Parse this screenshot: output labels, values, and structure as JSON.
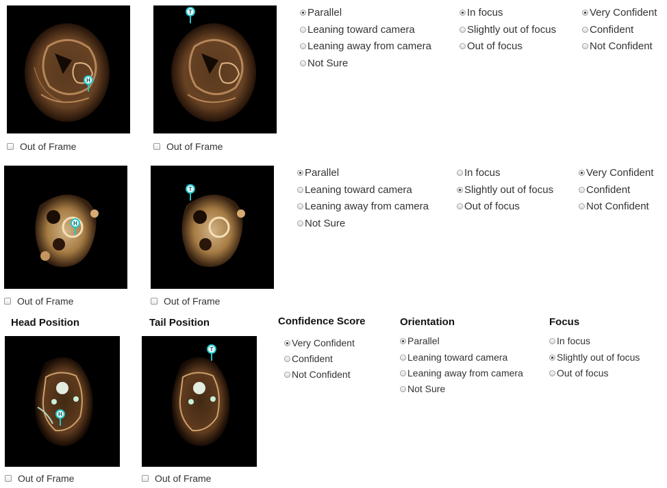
{
  "out_of_frame_label": "Out of Frame",
  "headers": {
    "head_position": "Head Position",
    "tail_position": "Tail Position",
    "confidence_score": "Confidence Score",
    "orientation": "Orientation",
    "focus": "Focus"
  },
  "orientation_options": [
    "Parallel",
    "Leaning toward camera",
    "Leaning away from camera",
    "Not Sure"
  ],
  "focus_options": [
    "In focus",
    "Slightly out of focus",
    "Out of focus"
  ],
  "confidence_options": [
    "Very Confident",
    "Confident",
    "Not Confident"
  ],
  "markers": {
    "head": "H",
    "tail": "T"
  },
  "rows": [
    {
      "orientation_selected": "Parallel",
      "focus_selected": "In focus",
      "confidence_selected": "Very Confident"
    },
    {
      "orientation_selected": "Parallel",
      "focus_selected": "Slightly out of focus",
      "confidence_selected": "Very Confident"
    },
    {
      "orientation_selected": "Parallel",
      "focus_selected": "Slightly out of focus",
      "confidence_selected": "Very Confident"
    }
  ],
  "colors": {
    "marker": "#21c4c9",
    "image_bg": "#000000"
  },
  "icons": {
    "checkbox": "checkbox-icon",
    "radio": "radio-icon"
  }
}
